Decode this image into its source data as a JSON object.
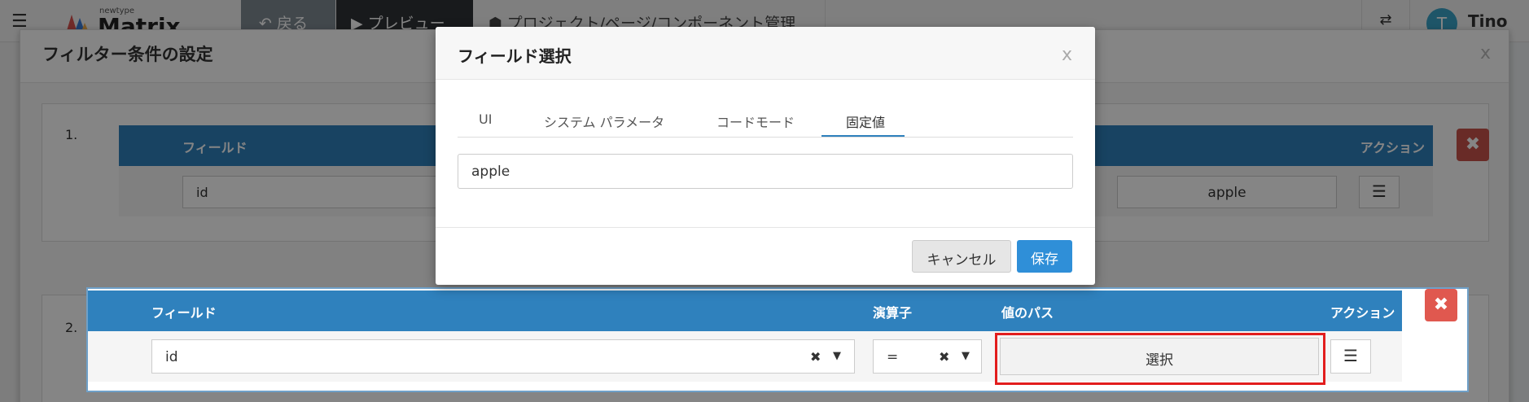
{
  "topbar": {
    "logo_sub": "newtype",
    "logo_main": "Matrix",
    "back_label": "戻る",
    "preview_label": "プレビュー",
    "manage_label": "プロジェクト/ページ/コンポーネント管理",
    "user_initial": "T",
    "user_name": "Tino"
  },
  "filter_panel": {
    "title": "フィルター条件の設定",
    "close_label": "x",
    "criteria": [
      {
        "number": "1.",
        "header_field": "フィールド",
        "header_action": "アクション",
        "field_value": "id",
        "value": "apple"
      },
      {
        "number": "2.",
        "header_field": "フィールド",
        "header_operator": "演算子",
        "header_value_path": "値のパス",
        "header_action": "アクション",
        "field_value": "id",
        "operator_value": "=",
        "select_label": "選択"
      }
    ]
  },
  "modal": {
    "title": "フィールド選択",
    "close_label": "x",
    "tabs": [
      {
        "label": "UI"
      },
      {
        "label": "システム パラメータ"
      },
      {
        "label": "コードモード"
      },
      {
        "label": "固定値"
      }
    ],
    "active_tab": "固定値",
    "input_value": "apple",
    "cancel_label": "キャンセル",
    "save_label": "保存"
  },
  "colors": {
    "header_blue": "#2f81bd",
    "save_blue": "#2f8fd8",
    "delete_red": "#e0584f",
    "highlight_red": "#e21d1d"
  }
}
